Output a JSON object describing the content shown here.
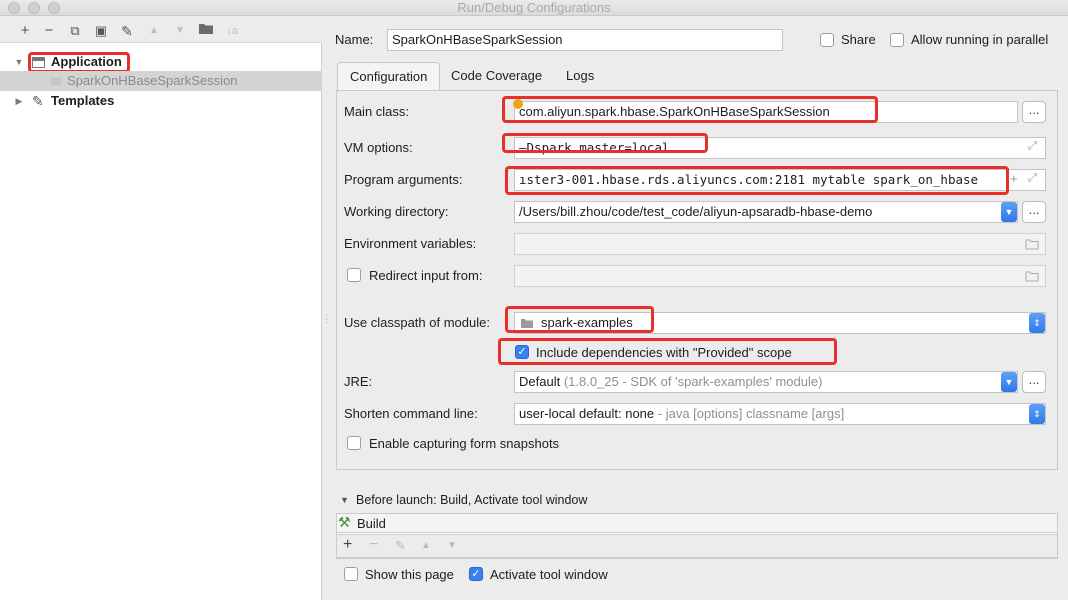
{
  "window": {
    "title": "Run/Debug Configurations"
  },
  "toolbar": {
    "add": "+",
    "remove": "−",
    "copy": "⧉",
    "save": "▣",
    "edit": "✎",
    "move_up": "▲",
    "move_down": "▼",
    "folder": "📁",
    "sort": "↓a"
  },
  "tree": {
    "group_label": "Application",
    "child_label": "SparkOnHBaseSparkSession",
    "templates_label": "Templates"
  },
  "header": {
    "name_label": "Name:",
    "name_value": "SparkOnHBaseSparkSession",
    "share_label": "Share",
    "parallel_label": "Allow running in parallel"
  },
  "tabs": [
    {
      "label": "Configuration"
    },
    {
      "label": "Code Coverage"
    },
    {
      "label": "Logs"
    }
  ],
  "form": {
    "main_class_label": "Main class:",
    "main_class_value": "com.aliyun.spark.hbase.SparkOnHBaseSparkSession",
    "vm_label": "VM options:",
    "vm_value": "—Dspark.master=local",
    "args_label": "Program arguments:",
    "args_value": "ıster3-001.hbase.rds.aliyuncs.com:2181 mytable spark_on_hbase",
    "workdir_label": "Working directory:",
    "workdir_value": "/Users/bill.zhou/code/test_code/aliyun-apsaradb-hbase-demo",
    "env_label": "Environment variables:",
    "redirect_label": "Redirect input from:",
    "classpath_label": "Use classpath of module:",
    "classpath_value": "spark-examples",
    "include_deps_label": "Include dependencies with \"Provided\" scope",
    "jre_label": "JRE:",
    "jre_value": "Default",
    "jre_hint": "(1.8.0_25 - SDK of 'spark-examples' module)",
    "shorten_label": "Shorten command line:",
    "shorten_value": "user-local default: none",
    "shorten_hint": "- java [options] classname [args]",
    "snapshots_label": "Enable capturing form snapshots",
    "dots": "..."
  },
  "before_launch": {
    "title": "Before launch: Build, Activate tool window",
    "item": "Build",
    "show_page_label": "Show this page",
    "activate_label": "Activate tool window"
  }
}
